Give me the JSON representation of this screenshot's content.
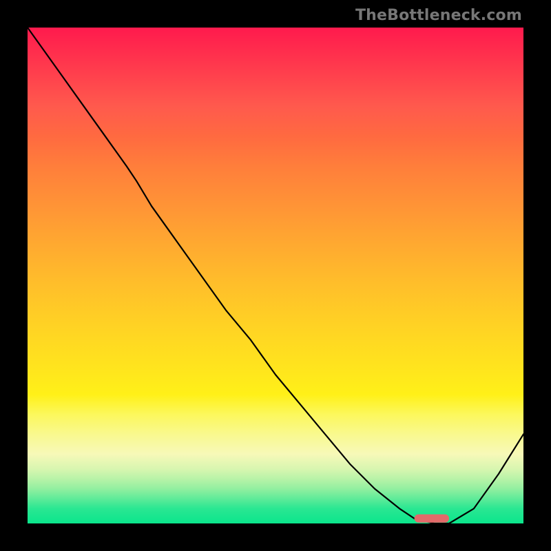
{
  "watermark": "TheBottleneck.com",
  "chart_data": {
    "type": "line",
    "title": "",
    "xlabel": "",
    "ylabel": "",
    "xlim": [
      0,
      100
    ],
    "ylim": [
      0,
      100
    ],
    "grid": false,
    "legend": false,
    "x": [
      0,
      5,
      10,
      15,
      20,
      22,
      25,
      30,
      35,
      40,
      45,
      50,
      55,
      60,
      65,
      70,
      75,
      78,
      82,
      85,
      90,
      95,
      100
    ],
    "y": [
      100,
      93,
      86,
      79,
      72,
      69,
      64,
      57,
      50,
      43,
      37,
      30,
      24,
      18,
      12,
      7,
      3,
      1,
      0,
      0,
      3,
      10,
      18
    ],
    "marker": {
      "x": [
        78,
        85
      ],
      "y": [
        1,
        1
      ],
      "color": "#e36a6a"
    },
    "background_gradient": {
      "stops": [
        {
          "pos": 0,
          "color": "#ff1a4d"
        },
        {
          "pos": 50,
          "color": "#ffbf2a"
        },
        {
          "pos": 80,
          "color": "#f9f98e"
        },
        {
          "pos": 100,
          "color": "#0be58c"
        }
      ]
    }
  }
}
